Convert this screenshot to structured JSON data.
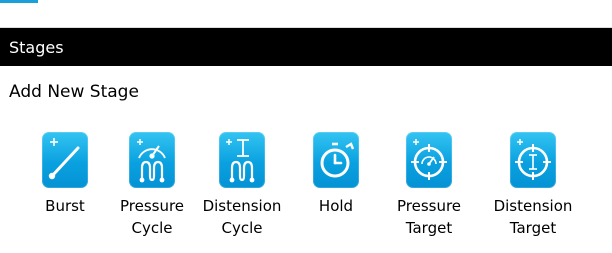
{
  "panel": {
    "title": "Stages",
    "subtitle": "Add New Stage"
  },
  "stages": [
    {
      "label_line1": "Burst",
      "label_line2": "",
      "icon": "burst-icon"
    },
    {
      "label_line1": "Pressure",
      "label_line2": "Cycle",
      "icon": "pressure-cycle-icon"
    },
    {
      "label_line1": "Distension",
      "label_line2": "Cycle",
      "icon": "distension-cycle-icon"
    },
    {
      "label_line1": "Hold",
      "label_line2": "",
      "icon": "hold-icon"
    },
    {
      "label_line1": "Pressure",
      "label_line2": "Target",
      "icon": "pressure-target-icon"
    },
    {
      "label_line1": "Distension",
      "label_line2": "Target",
      "icon": "distension-target-icon"
    }
  ],
  "colors": {
    "header_bg": "#000000",
    "header_text": "#ffffff",
    "icon_blue": "#0aa1e0",
    "accent": "#1aa0d8"
  }
}
